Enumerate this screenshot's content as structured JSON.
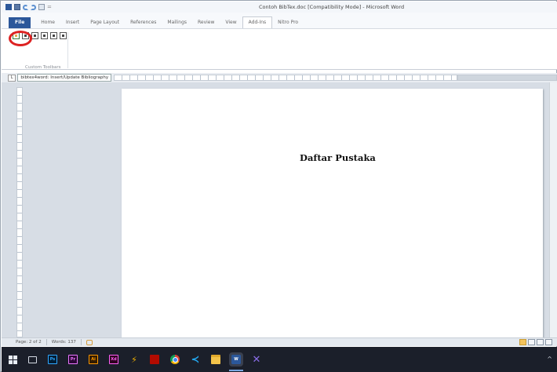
{
  "window": {
    "title": "Contoh BibTex.doc [Compatibility Mode] - Microsoft Word"
  },
  "ribbon": {
    "tabs": [
      {
        "label": "File"
      },
      {
        "label": "Home"
      },
      {
        "label": "Insert"
      },
      {
        "label": "Page Layout"
      },
      {
        "label": "References"
      },
      {
        "label": "Mailings"
      },
      {
        "label": "Review"
      },
      {
        "label": "View"
      },
      {
        "label": "Add-Ins"
      },
      {
        "label": "Nitro Pro"
      }
    ],
    "active_tab": "Add-Ins",
    "group_label": "Custom Toolbars",
    "toolbar_icons": [
      "bibtex-insert-icon",
      "bibtex-update-icon",
      "bibtex-toggle-icon",
      "bibtex-citation-icon",
      "bibtex-settings-icon",
      "bibtex-help-icon"
    ]
  },
  "tooltip": {
    "text": "bibtex4word: Insert/Update Bibliography"
  },
  "document": {
    "heading": "Daftar Pustaka"
  },
  "statusbar": {
    "page": "Page: 2 of 2",
    "words": "Words: 137"
  },
  "taskbar": {
    "apps": [
      "start",
      "task-view",
      "Ps",
      "Pr",
      "Ai",
      "Xd",
      "bolt",
      "acrobat",
      "chrome",
      "vscode",
      "file-explorer",
      "W",
      "visual-studio"
    ],
    "labels": {
      "ps": "Ps",
      "pr": "Pr",
      "ai": "Ai",
      "xd": "Xd",
      "word": "W"
    },
    "tray": "^"
  },
  "colors": {
    "word_blue": "#2b579a",
    "highlight_red": "#d22222",
    "taskbar_bg": "#1b1f2a"
  }
}
